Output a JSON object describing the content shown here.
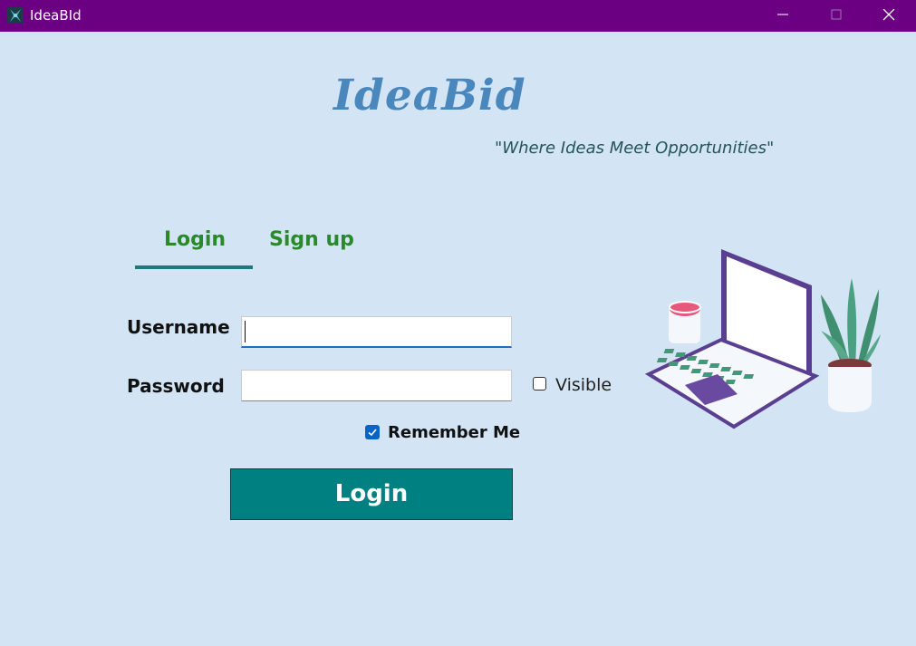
{
  "window": {
    "title": "IdeaBId",
    "icon": "app-icon",
    "controls": [
      "minimize-icon",
      "maximize-icon",
      "close-icon"
    ]
  },
  "brand": {
    "logo_text": "IdeaBid",
    "tagline": "\"Where Ideas Meet Opportunities\"",
    "logo_color": "#4a87bd"
  },
  "tabs": [
    {
      "label": "Login",
      "active": true
    },
    {
      "label": "Sign up",
      "active": false
    }
  ],
  "form": {
    "username_label": "Username",
    "username_value": "",
    "password_label": "Password",
    "password_value": "",
    "visible_label": "Visible",
    "visible_checked": false,
    "remember_label": "Remember Me",
    "remember_checked": true,
    "submit_label": "Login"
  },
  "colors": {
    "titlebar": "#6c0083",
    "background": "#d3e5f5",
    "accent": "#008080",
    "tab_text": "#2a8a2a"
  },
  "illustration": "laptop-coffee-plant-illustration"
}
